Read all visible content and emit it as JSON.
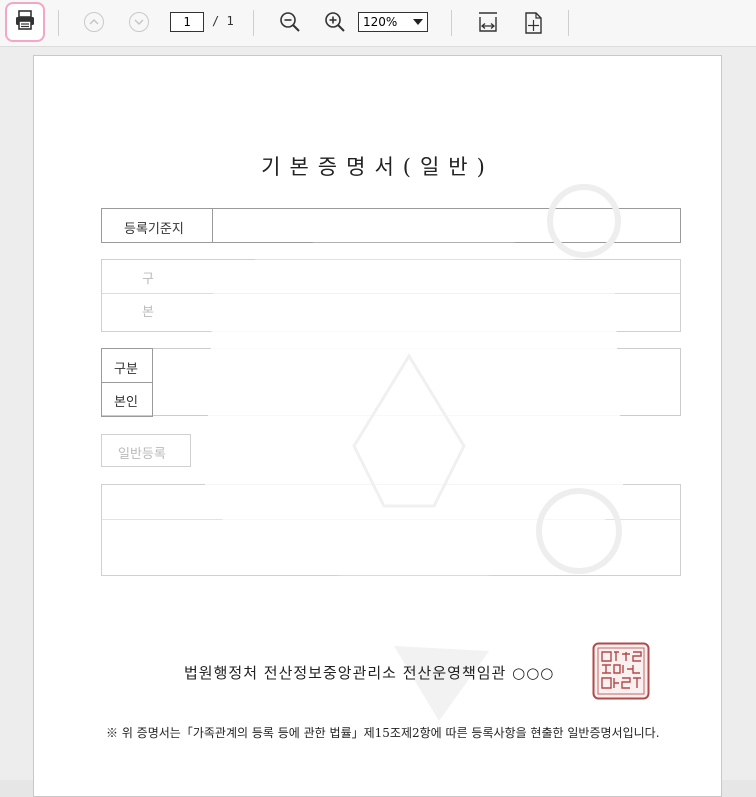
{
  "toolbar": {
    "current_page": "1",
    "total_pages": "/ 1",
    "zoom": "120%",
    "icons": [
      "print-icon",
      "page-up-icon",
      "page-down-icon",
      "zoom-out-icon",
      "zoom-in-icon",
      "fit-width-icon",
      "fit-page-icon"
    ]
  },
  "document": {
    "title": "기본증명서(일반)",
    "rows": {
      "registry_label": "등록기준지",
      "section1_label_a": "구",
      "section1_label_b": "본",
      "row_gubun": "구분",
      "row_bonin": "본인",
      "general_label": "일반등록"
    },
    "authority": "법원행정처 전산정보중앙관리소 전산운영책임관 ○○○",
    "seal_text": "전산정보중앙관리소 전산운영책임관인",
    "note": "※ 위 증명서는「가족관계의 등록 등에 관한 법률」제15조제2항에 따른 등록사항을 현출한 일반증명서입니다."
  }
}
